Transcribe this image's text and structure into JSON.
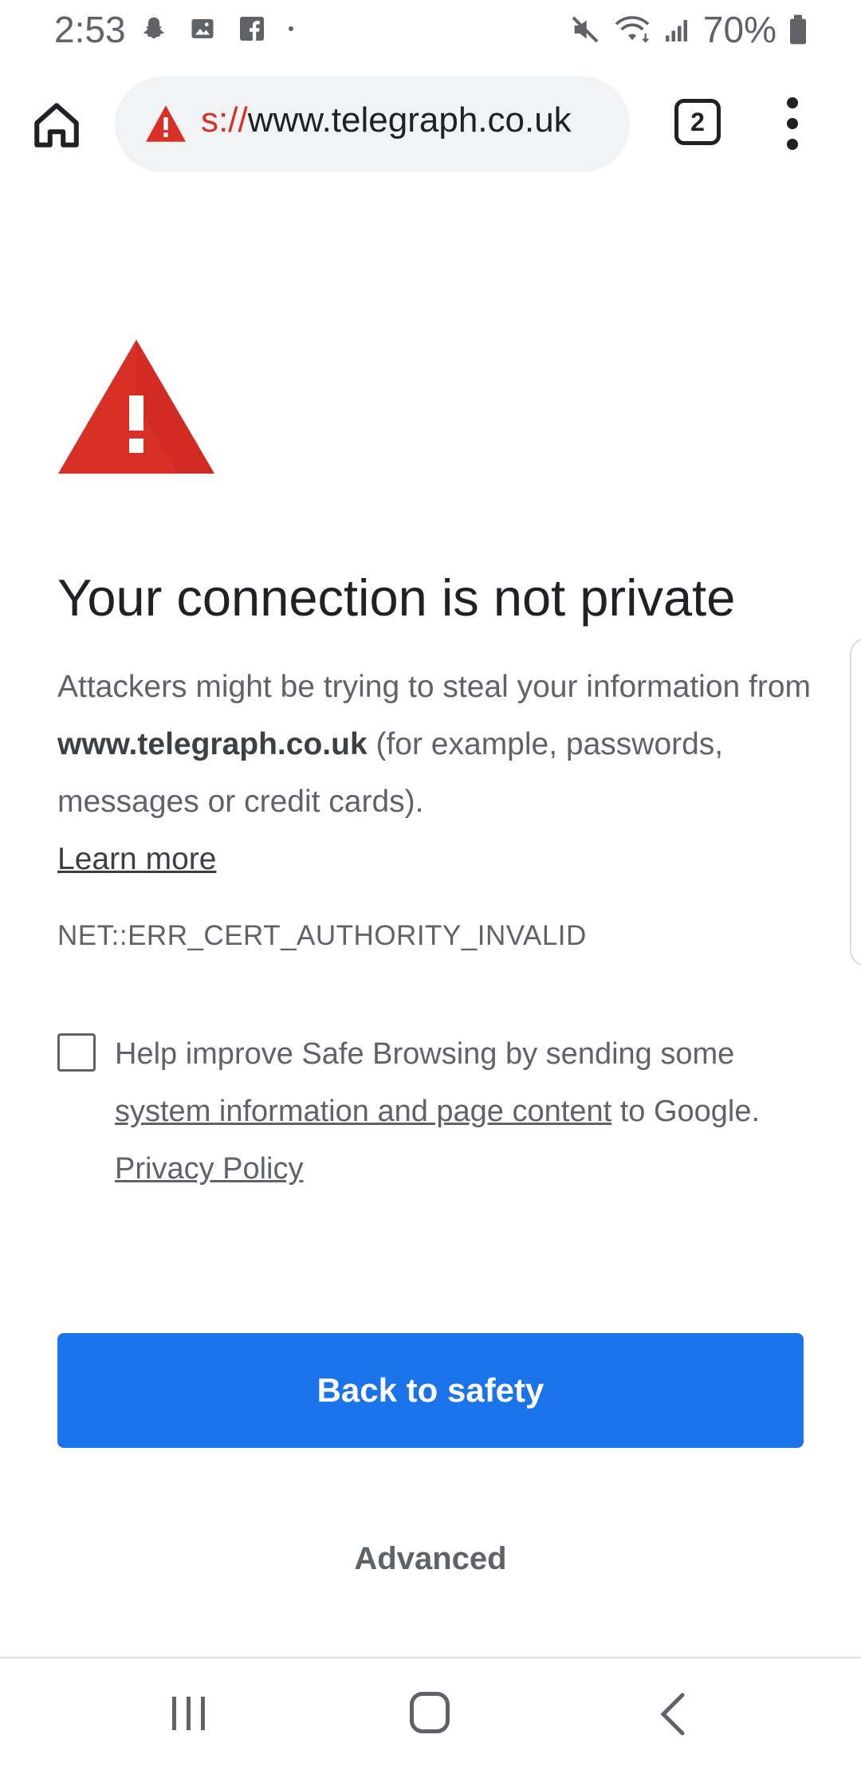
{
  "status_bar": {
    "time": "2:53",
    "battery_percent": "70%",
    "left_icons": [
      "snapchat-icon",
      "gallery-icon",
      "facebook-icon",
      "dot-icon"
    ],
    "right_icons": [
      "mute-icon",
      "wifi-icon",
      "signal-icon",
      "battery-icon"
    ]
  },
  "toolbar": {
    "url_scheme": "s://",
    "url_host": "www.telegraph.co.uk",
    "tab_count": "2"
  },
  "interstitial": {
    "headline": "Your connection is not private",
    "explanation_before": "Attackers might be trying to steal your information from ",
    "site": "www.telegraph.co.uk",
    "explanation_after": " (for example, passwords, messages or credit cards).",
    "learn_more": "Learn more",
    "error_code": "NET::ERR_CERT_AUTHORITY_INVALID",
    "safe_browsing": {
      "checked": false,
      "text_before": "Help improve Safe Browsing by sending some ",
      "link_text": "system information and page content",
      "text_after": " to Google.",
      "privacy_link": "Privacy Policy"
    },
    "primary_button": "Back to safety",
    "advanced_button": "Advanced"
  },
  "colors": {
    "accent": "#1a73e8",
    "warning": "#d93025",
    "text_primary": "#202124",
    "text_secondary": "#5f6368"
  }
}
